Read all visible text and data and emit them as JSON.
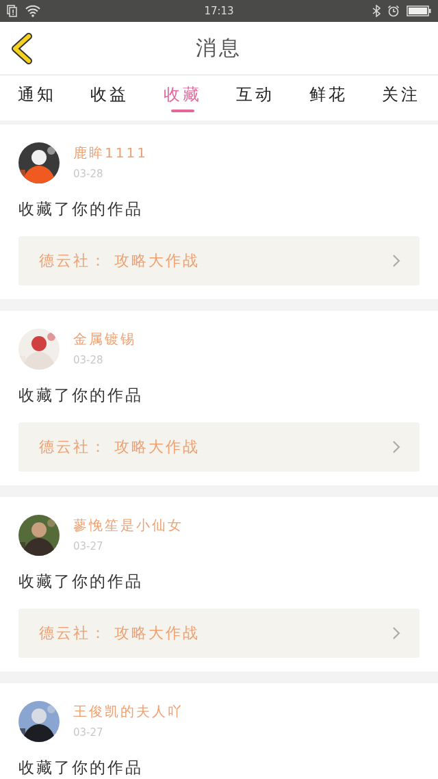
{
  "status_bar": {
    "time": "17:13"
  },
  "header": {
    "title": "消息"
  },
  "tabs": [
    {
      "label": "通知",
      "selected": false
    },
    {
      "label": "收益",
      "selected": false
    },
    {
      "label": "收藏",
      "selected": true
    },
    {
      "label": "互动",
      "selected": false
    },
    {
      "label": "鲜花",
      "selected": false
    },
    {
      "label": "关注",
      "selected": false
    }
  ],
  "messages": [
    {
      "user": "鹿眸1111",
      "date": "03-28",
      "text": "收藏了你的作品",
      "work": "德云社： 攻略大作战"
    },
    {
      "user": "金属镀锡",
      "date": "03-28",
      "text": "收藏了你的作品",
      "work": "德云社： 攻略大作战"
    },
    {
      "user": "蓼悗笙是小仙女",
      "date": "03-27",
      "text": "收藏了你的作品",
      "work": "德云社： 攻略大作战"
    },
    {
      "user": "王俊凯的夫人吖",
      "date": "03-27",
      "text": "收藏了你的作品"
    }
  ]
}
